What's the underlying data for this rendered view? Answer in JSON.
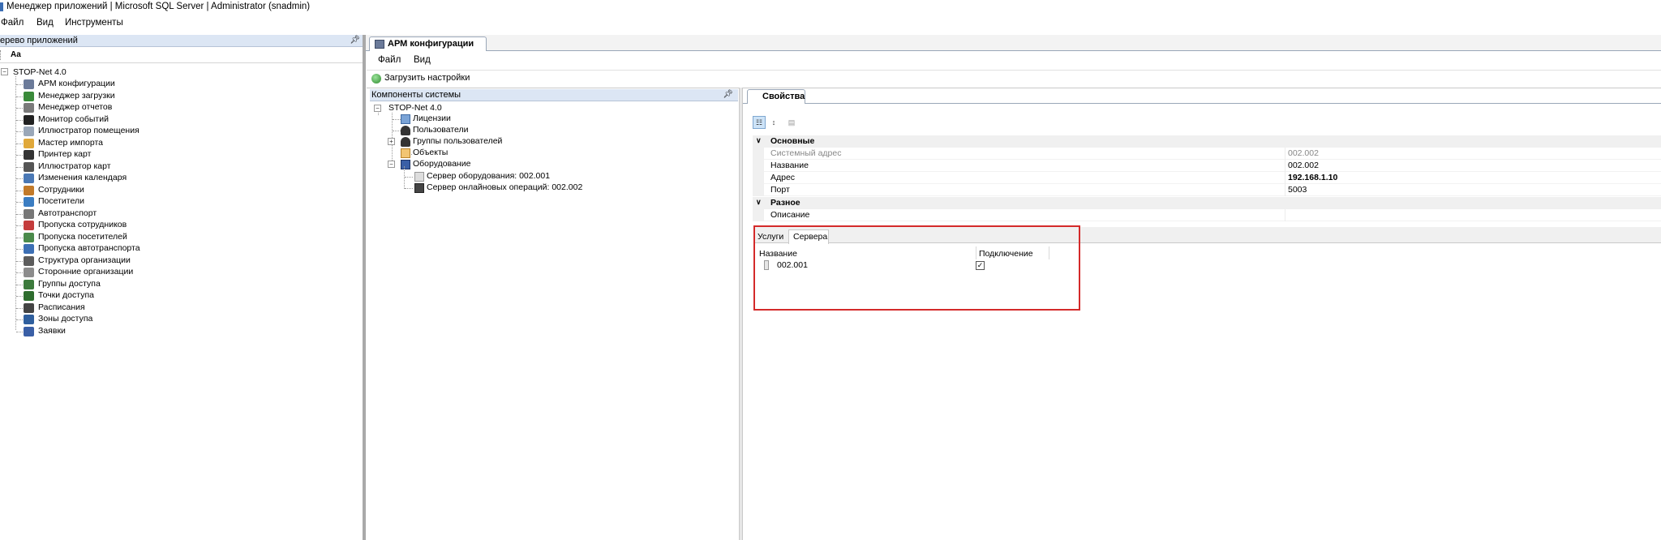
{
  "window": {
    "title": "Менеджер приложений | Microsoft SQL Server | Administrator  (snadmin)"
  },
  "menubar": {
    "file": "Файл",
    "view": "Вид",
    "tools": "Инструменты"
  },
  "left_panel": {
    "header": "ерево приложений",
    "font_button": "Aa",
    "root": "STOP-Net 4.0",
    "items": [
      {
        "label": "АРМ конфигурации",
        "icon": "config-icon"
      },
      {
        "label": "Менеджер загрузки",
        "icon": "download-icon"
      },
      {
        "label": "Менеджер отчетов",
        "icon": "report-icon"
      },
      {
        "label": "Монитор событий",
        "icon": "monitor-icon"
      },
      {
        "label": "Иллюстратор помещения",
        "icon": "room-icon"
      },
      {
        "label": "Мастер импорта",
        "icon": "import-icon"
      },
      {
        "label": "Принтер карт",
        "icon": "printer-icon"
      },
      {
        "label": "Иллюстратор карт",
        "icon": "card-icon"
      },
      {
        "label": "Изменения календаря",
        "icon": "calendar-icon"
      },
      {
        "label": "Сотрудники",
        "icon": "employees-icon"
      },
      {
        "label": "Посетители",
        "icon": "visitors-icon"
      },
      {
        "label": "Автотранспорт",
        "icon": "car-icon"
      },
      {
        "label": "Пропуска сотрудников",
        "icon": "employee-pass-icon"
      },
      {
        "label": "Пропуска посетителей",
        "icon": "visitor-pass-icon"
      },
      {
        "label": "Пропуска автотранспорта",
        "icon": "vehicle-pass-icon"
      },
      {
        "label": "Структура организации",
        "icon": "org-structure-icon"
      },
      {
        "label": "Сторонние организации",
        "icon": "third-party-icon"
      },
      {
        "label": "Группы доступа",
        "icon": "access-group-icon"
      },
      {
        "label": "Точки доступа",
        "icon": "access-point-icon"
      },
      {
        "label": "Расписания",
        "icon": "schedule-icon"
      },
      {
        "label": "Зоны доступа",
        "icon": "access-zone-icon"
      },
      {
        "label": "Заявки",
        "icon": "requests-icon"
      }
    ]
  },
  "document": {
    "tab_label": "АРМ конфигурации",
    "menu_file": "Файл",
    "menu_view": "Вид",
    "load_settings": "Загрузить настройки"
  },
  "components": {
    "header": "Компоненты системы",
    "root": "STOP-Net 4.0",
    "licenses": "Лицензии",
    "users": "Пользователи",
    "user_groups": "Группы пользователей",
    "objects": "Объекты",
    "equipment": "Оборудование",
    "equipment_server": "Сервер оборудования: 002.001",
    "online_server": "Сервер онлайновых операций: 002.002"
  },
  "properties": {
    "tab_label": "Свойства",
    "cat_main": "Основные",
    "cat_misc": "Разное",
    "rows": [
      {
        "name": "Системный адрес",
        "value": "002.002",
        "dim": true
      },
      {
        "name": "Название",
        "value": "002.002"
      },
      {
        "name": "Адрес",
        "value": "192.168.1.10",
        "bold": true
      },
      {
        "name": "Порт",
        "value": "5003"
      }
    ],
    "desc_name": "Описание",
    "desc_value": ""
  },
  "subtabs": {
    "services": "Услуги",
    "servers": "Сервера"
  },
  "servers_table": {
    "col_name": "Название",
    "col_connection": "Подключение",
    "rows": [
      {
        "name": "002.001",
        "connected": true
      }
    ]
  },
  "colors": {
    "panel_header": "#dce6f4",
    "highlight": "#d42a2a",
    "splitter": "#a9a9a9"
  }
}
